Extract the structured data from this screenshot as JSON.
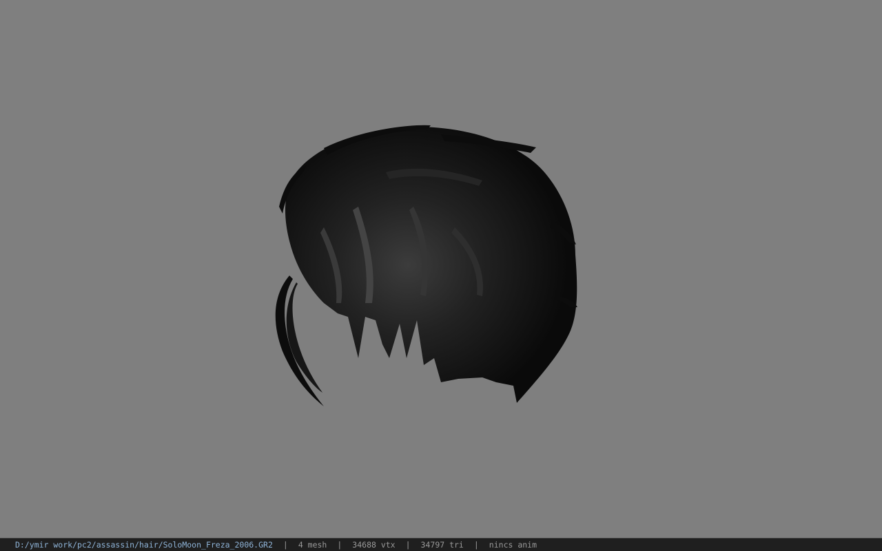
{
  "viewport": {
    "background_color": "#7f7f7f",
    "model_color": "#0c0c0c",
    "model_highlight_color": "#3c3c3c",
    "model_name": "hair-mesh"
  },
  "statusbar": {
    "file_path": "D:/ymir work/pc2/assassin/hair/SoloMoon_Freza_2006.GR2",
    "separator": "|",
    "mesh_count": "4 mesh",
    "vertex_count": "34688 vtx",
    "triangle_count": "34797 tri",
    "anim_status": "nincs anim"
  }
}
